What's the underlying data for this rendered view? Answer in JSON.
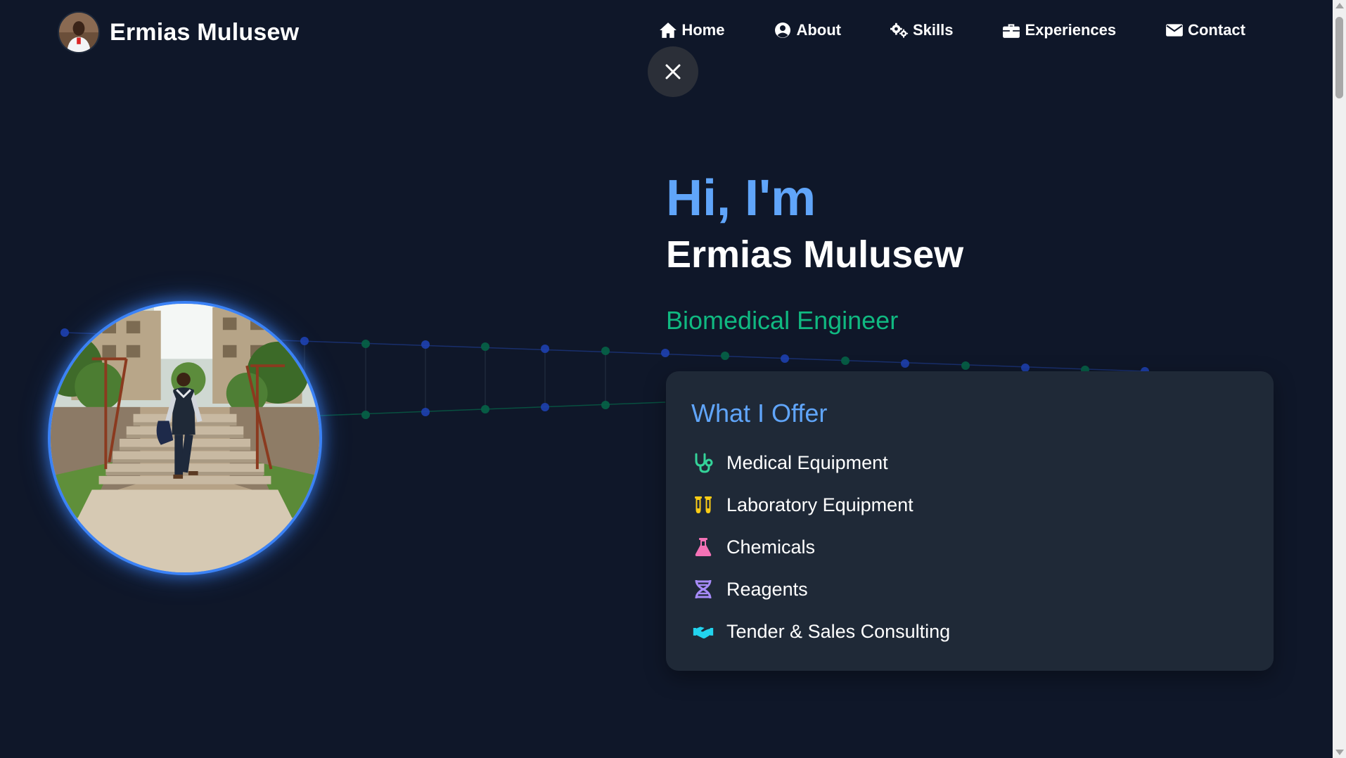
{
  "brand": {
    "name": "Ermias Mulusew"
  },
  "nav": {
    "items": [
      {
        "label": "Home",
        "icon": "home-icon"
      },
      {
        "label": "About",
        "icon": "user-circle-icon"
      },
      {
        "label": "Skills",
        "icon": "gears-icon"
      },
      {
        "label": "Experiences",
        "icon": "briefcase-icon"
      },
      {
        "label": "Contact",
        "icon": "envelope-icon"
      }
    ]
  },
  "close": {
    "icon": "close-icon"
  },
  "hero": {
    "greeting": "Hi, I'm",
    "name": "Ermias Mulusew",
    "role": "Biomedical Engineer"
  },
  "offer": {
    "title": "What I Offer",
    "items": [
      {
        "label": "Medical Equipment",
        "icon": "stethoscope-icon",
        "color": "#34d399"
      },
      {
        "label": "Laboratory Equipment",
        "icon": "test-tubes-icon",
        "color": "#facc15"
      },
      {
        "label": "Chemicals",
        "icon": "flask-icon",
        "color": "#f472b6"
      },
      {
        "label": "Reagents",
        "icon": "dna-icon",
        "color": "#a78bfa"
      },
      {
        "label": "Tender & Sales Consulting",
        "icon": "handshake-icon",
        "color": "#22d3ee"
      }
    ]
  },
  "colors": {
    "background": "#0f1729",
    "accent_blue": "#60a5fa",
    "accent_green": "#10b981",
    "card": "#1f2937"
  }
}
